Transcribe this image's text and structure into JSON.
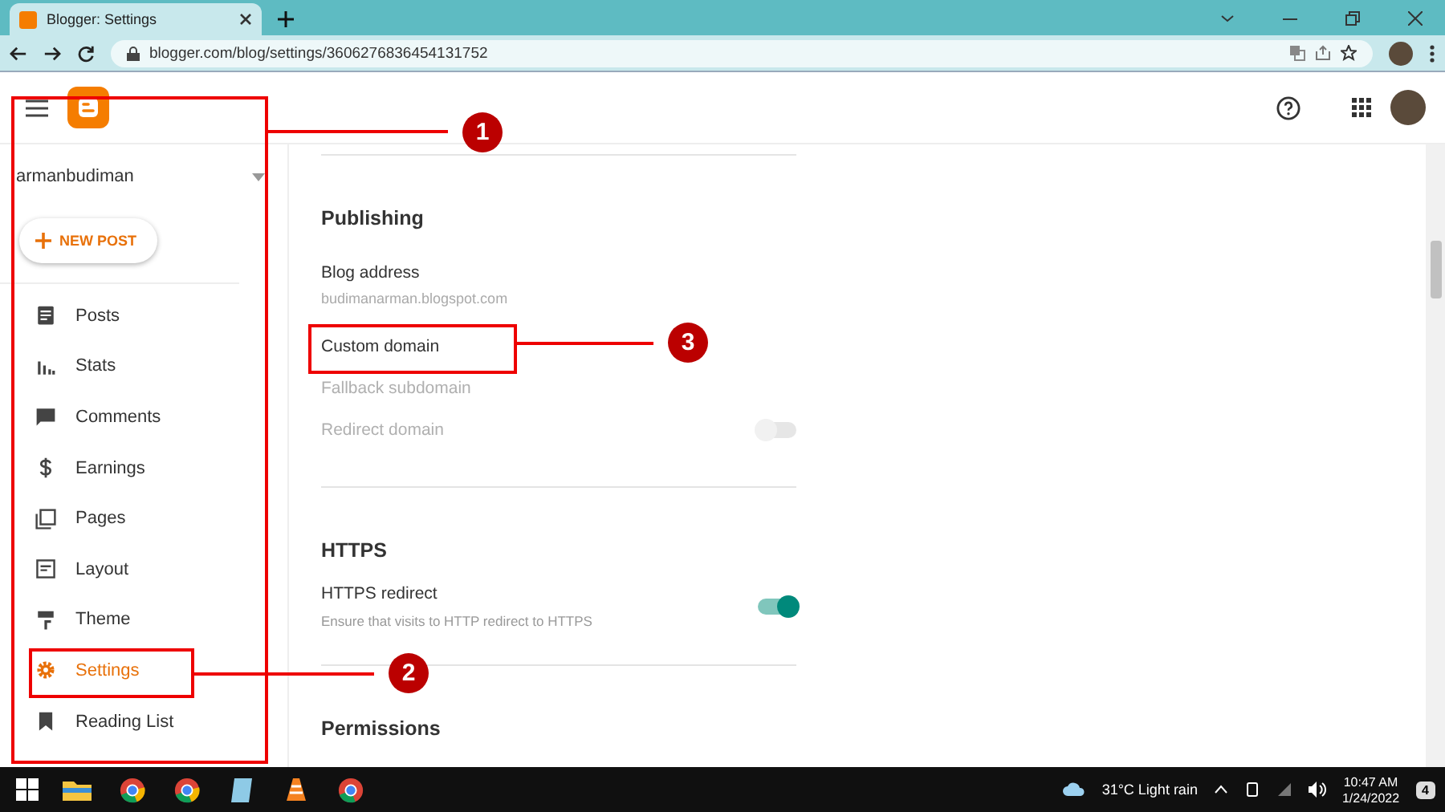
{
  "browser": {
    "tab_title": "Blogger: Settings",
    "url": "blogger.com/blog/settings/3606276836454131752"
  },
  "sidebar": {
    "blog_name": "armanbudiman",
    "new_post": "NEW POST",
    "items": [
      {
        "kind": "posts",
        "label": "Posts",
        "selected": false
      },
      {
        "kind": "stats",
        "label": "Stats",
        "selected": false
      },
      {
        "kind": "comments",
        "label": "Comments",
        "selected": false
      },
      {
        "kind": "earnings",
        "label": "Earnings",
        "selected": false
      },
      {
        "kind": "pages",
        "label": "Pages",
        "selected": false
      },
      {
        "kind": "layout",
        "label": "Layout",
        "selected": false
      },
      {
        "kind": "theme",
        "label": "Theme",
        "selected": false
      },
      {
        "kind": "settings",
        "label": "Settings",
        "selected": true
      },
      {
        "kind": "reading",
        "label": "Reading List",
        "selected": false
      }
    ]
  },
  "sections": [
    {
      "title": "Publishing",
      "rows": [
        {
          "label": "Blog address",
          "disabled": false
        },
        {
          "label": "budimanarman.blogspot.com",
          "kind": "sub"
        },
        {
          "label": "Custom domain",
          "disabled": false
        },
        {
          "label": "Fallback subdomain",
          "disabled": true
        },
        {
          "label": "Redirect domain",
          "disabled": true,
          "toggle": {
            "on": false
          }
        }
      ]
    },
    {
      "title": "HTTPS",
      "rows": [
        {
          "label": "HTTPS redirect",
          "disabled": false,
          "description": "Ensure that visits to HTTP redirect to HTTPS",
          "toggle": {
            "on": true
          }
        }
      ]
    },
    {
      "title": "Permissions"
    }
  ],
  "callouts": [
    "1",
    "2",
    "3"
  ],
  "taskbar": {
    "weather": "31°C  Light rain",
    "time": "10:47 AM",
    "date": "1/24/2022",
    "notifications": "4"
  }
}
